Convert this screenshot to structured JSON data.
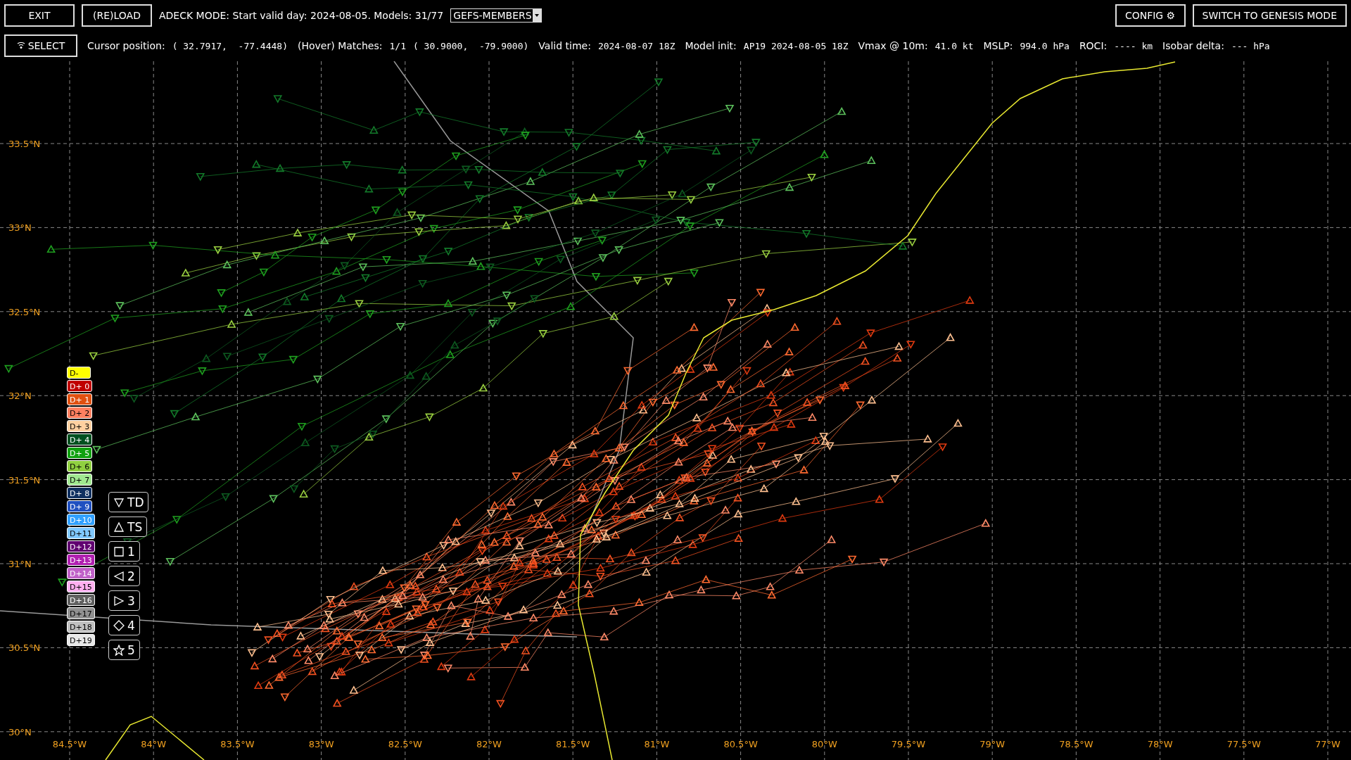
{
  "toolbar": {
    "buttons": [
      {
        "label": "EXIT"
      },
      {
        "label": "(RE)LOAD"
      }
    ],
    "mode_text": "ADECK MODE: Start valid day: 2024-08-05. Models: 31/77",
    "dropdown": {
      "value": "GEFS-MEMBERS"
    },
    "right_buttons": [
      {
        "label": "CONFIG ⚙"
      },
      {
        "label": "SWITCH TO GENESIS MODE"
      }
    ]
  },
  "status_bar": {
    "select_button": {
      "label": "SELECT"
    },
    "fields": [
      {
        "label": "Cursor position:",
        "values": [
          "( 32.7917,  -77.4448)"
        ]
      },
      {
        "label": "(Hover) Matches:",
        "values": [
          "1/1",
          "( 30.9000,  -79.9000)"
        ]
      },
      {
        "label": "Valid time:",
        "values": [
          "2024-08-07 18Z"
        ]
      },
      {
        "label": "Model init:",
        "values": [
          "AP19 2024-08-05 18Z"
        ]
      },
      {
        "label": "Vmax @ 10m:",
        "values": [
          "41.0 kt"
        ]
      },
      {
        "label": "MSLP:",
        "values": [
          "994.0 hPa"
        ]
      },
      {
        "label": "ROCI:",
        "values": [
          "---- km"
        ]
      },
      {
        "label": "Isobar delta:",
        "values": [
          "--- hPa"
        ]
      }
    ]
  },
  "map": {
    "lat_labels": [
      "33.5°N",
      "33°N",
      "32.5°N",
      "32°N",
      "31.5°N",
      "31°N",
      "30.5°N",
      "30°N"
    ],
    "lon_labels": [
      "84.5°W",
      "84°W",
      "83.5°W",
      "83°W",
      "82.5°W",
      "82°W",
      "81.5°W",
      "81°W",
      "80.5°W",
      "80°W",
      "79.5°W",
      "79°W",
      "78.5°W",
      "78°W",
      "77.5°W",
      "77°W"
    ],
    "day_legend": [
      {
        "label": "D-",
        "color": "#ffff00"
      },
      {
        "label": "D+ 0",
        "color": "#c00000"
      },
      {
        "label": "D+ 1",
        "color": "#e05010"
      },
      {
        "label": "D+ 2",
        "color": "#ff8060"
      },
      {
        "label": "D+ 3",
        "color": "#ffd0a0"
      },
      {
        "label": "D+ 4",
        "color": "#005020"
      },
      {
        "label": "D+ 5",
        "color": "#10a010"
      },
      {
        "label": "D+ 6",
        "color": "#90d040"
      },
      {
        "label": "D+ 7",
        "color": "#a0e890"
      },
      {
        "label": "D+ 8",
        "color": "#103060"
      },
      {
        "label": "D+ 9",
        "color": "#2050c0"
      },
      {
        "label": "D+10",
        "color": "#30a0ff"
      },
      {
        "label": "D+11",
        "color": "#80c8ff"
      },
      {
        "label": "D+12",
        "color": "#600070"
      },
      {
        "label": "D+13",
        "color": "#b020b0"
      },
      {
        "label": "D+14",
        "color": "#c060c8"
      },
      {
        "label": "D+15",
        "color": "#ffb0f0"
      },
      {
        "label": "D+16",
        "color": "#606060"
      },
      {
        "label": "D+17",
        "color": "#909090"
      },
      {
        "label": "D+18",
        "color": "#c0c0c0"
      },
      {
        "label": "D+19",
        "color": "#e8e8e8"
      }
    ],
    "intensity_legend": [
      {
        "kind": "td",
        "label": "TD"
      },
      {
        "kind": "ts",
        "label": "TS"
      },
      {
        "kind": "cat1",
        "label": "1"
      },
      {
        "kind": "cat2",
        "label": "2"
      },
      {
        "kind": "cat3",
        "label": "3"
      },
      {
        "kind": "cat4",
        "label": "4"
      },
      {
        "kind": "cat5",
        "label": "5"
      }
    ]
  }
}
